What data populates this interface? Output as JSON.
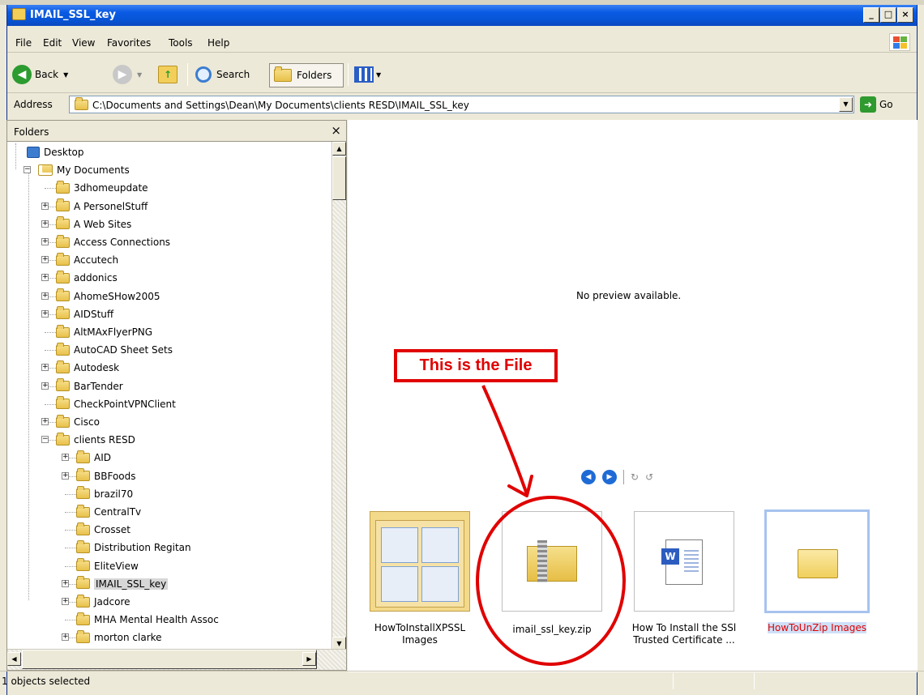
{
  "window": {
    "title": "IMAIL_SSL_key",
    "caption_buttons": [
      "_",
      "□",
      "×"
    ]
  },
  "menu": {
    "items": [
      "File",
      "Edit",
      "View",
      "Favorites",
      "Tools",
      "Help"
    ]
  },
  "toolbar": {
    "back_label": "Back",
    "search_label": "Search",
    "folders_label": "Folders",
    "icons": [
      "back-arrow-icon",
      "forward-arrow-icon",
      "up-folder-icon",
      "search-icon",
      "folders-icon",
      "views-icon"
    ]
  },
  "address": {
    "label": "Address",
    "value": "C:\\Documents and Settings\\Dean\\My Documents\\clients RESD\\IMAIL_SSL_key",
    "go_label": "Go"
  },
  "folders_pane": {
    "title": "Folders",
    "close": "×",
    "tree": [
      {
        "label": "Desktop",
        "level": 0,
        "expander": "",
        "icon": "desktop-icon"
      },
      {
        "label": "My Documents",
        "level": 1,
        "expander": "-",
        "icon": "my-documents-icon"
      },
      {
        "label": "3dhomeupdate",
        "level": 2,
        "expander": "",
        "icon": "folder-icon"
      },
      {
        "label": "A PersonelStuff",
        "level": 2,
        "expander": "+",
        "icon": "folder-icon"
      },
      {
        "label": "A Web Sites",
        "level": 2,
        "expander": "+",
        "icon": "folder-icon"
      },
      {
        "label": "Access Connections",
        "level": 2,
        "expander": "+",
        "icon": "folder-icon"
      },
      {
        "label": "Accutech",
        "level": 2,
        "expander": "+",
        "icon": "folder-icon"
      },
      {
        "label": "addonics",
        "level": 2,
        "expander": "+",
        "icon": "folder-icon"
      },
      {
        "label": "AhomeSHow2005",
        "level": 2,
        "expander": "+",
        "icon": "folder-icon"
      },
      {
        "label": "AIDStuff",
        "level": 2,
        "expander": "+",
        "icon": "folder-icon"
      },
      {
        "label": "AltMAxFlyerPNG",
        "level": 2,
        "expander": "",
        "icon": "folder-icon"
      },
      {
        "label": "AutoCAD Sheet Sets",
        "level": 2,
        "expander": "",
        "icon": "folder-icon"
      },
      {
        "label": "Autodesk",
        "level": 2,
        "expander": "+",
        "icon": "folder-icon"
      },
      {
        "label": "BarTender",
        "level": 2,
        "expander": "+",
        "icon": "folder-icon"
      },
      {
        "label": "CheckPointVPNClient",
        "level": 2,
        "expander": "",
        "icon": "folder-icon"
      },
      {
        "label": "Cisco",
        "level": 2,
        "expander": "+",
        "icon": "folder-icon"
      },
      {
        "label": "clients RESD",
        "level": 2,
        "expander": "-",
        "icon": "folder-icon"
      },
      {
        "label": "AID",
        "level": 3,
        "expander": "+",
        "icon": "folder-icon"
      },
      {
        "label": "BBFoods",
        "level": 3,
        "expander": "+",
        "icon": "folder-icon"
      },
      {
        "label": "brazil70",
        "level": 3,
        "expander": "",
        "icon": "folder-icon"
      },
      {
        "label": "CentralTv",
        "level": 3,
        "expander": "",
        "icon": "folder-icon"
      },
      {
        "label": "Crosset",
        "level": 3,
        "expander": "",
        "icon": "folder-icon"
      },
      {
        "label": "Distribution Regitan",
        "level": 3,
        "expander": "",
        "icon": "folder-icon"
      },
      {
        "label": "EliteView",
        "level": 3,
        "expander": "",
        "icon": "folder-icon"
      },
      {
        "label": "IMAIL_SSL_key",
        "level": 3,
        "expander": "+",
        "icon": "folder-icon",
        "selected": true
      },
      {
        "label": "Jadcore",
        "level": 3,
        "expander": "+",
        "icon": "folder-icon"
      },
      {
        "label": "MHA Mental Health Assoc",
        "level": 3,
        "expander": "",
        "icon": "folder-icon"
      },
      {
        "label": "morton clarke",
        "level": 3,
        "expander": "+",
        "icon": "folder-icon"
      }
    ]
  },
  "preview": {
    "message": "No preview available.",
    "nav_icons": [
      "previous-image-icon",
      "next-image-icon",
      "rotate-clockwise-icon",
      "rotate-counterclockwise-icon"
    ]
  },
  "annotation": {
    "text": "This is the File",
    "color": "#e00000"
  },
  "files": [
    {
      "label": "HowToInstallXPSSL Images",
      "icon": "folder-thumbnail-icon"
    },
    {
      "label": "imail_ssl_key.zip",
      "icon": "zip-folder-icon"
    },
    {
      "label": "How To Install the SSl Trusted Certificate ...",
      "icon": "word-document-icon"
    },
    {
      "label": "HowToUnZip Images",
      "icon": "folder-icon",
      "selected": true
    }
  ],
  "status": {
    "text": "1 objects selected"
  },
  "colors": {
    "titlebar": "#0a5ae4",
    "selection": "#1f6bd6",
    "annotation": "#e00000"
  }
}
